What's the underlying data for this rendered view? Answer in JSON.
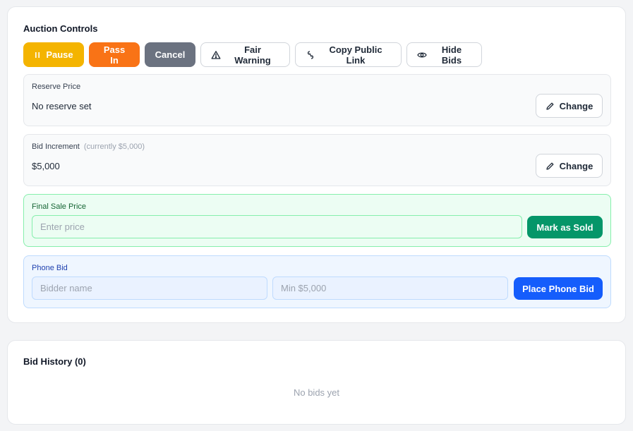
{
  "controls": {
    "title": "Auction Controls",
    "buttons": {
      "pause": "Pause",
      "pass_in": "Pass In",
      "cancel": "Cancel",
      "fair_warning": "Fair Warning",
      "copy_link": "Copy Public Link",
      "hide_bids": "Hide Bids"
    },
    "icons": {
      "pause": "pause-icon",
      "fair_warning": "warning-triangle-icon",
      "copy_link": "link-icon",
      "hide_bids": "eye-icon",
      "change": "pencil-icon"
    },
    "colors": {
      "pause": "#f4b400",
      "pass_in": "#f97316",
      "cancel": "#6b7280",
      "mark_sold": "#059669",
      "phone_bid": "#155dfc"
    }
  },
  "reserve": {
    "label": "Reserve Price",
    "value": "No reserve set",
    "change_label": "Change"
  },
  "increment": {
    "label": "Bid Increment",
    "note": "(currently $5,000)",
    "value": "$5,000",
    "change_label": "Change"
  },
  "final_sale": {
    "label": "Final Sale Price",
    "placeholder": "Enter price",
    "value": "",
    "button": "Mark as Sold"
  },
  "phone_bid": {
    "label": "Phone Bid",
    "bidder_placeholder": "Bidder name",
    "bidder_value": "",
    "amount_placeholder": "Min $5,000",
    "amount_value": "",
    "button": "Place Phone Bid"
  },
  "history": {
    "title": "Bid History (0)",
    "empty": "No bids yet"
  }
}
